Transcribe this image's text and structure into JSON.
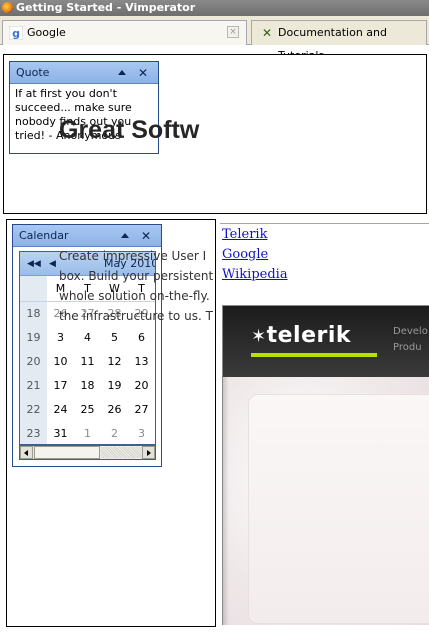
{
  "window": {
    "title": "Getting Started - Vimperator"
  },
  "tabs": [
    {
      "label": "Google",
      "icon": "google-icon"
    },
    {
      "label": "Documentation and Tutorials",
      "icon": "vimperator-icon"
    }
  ],
  "quote_widget": {
    "title": "Quote",
    "text": "If at first you don't succeed... make sure nobody finds out you tried! - Anonymous"
  },
  "calendar_widget": {
    "title": "Calendar",
    "month_label": "May 2010",
    "weekday_headers": [
      "M",
      "T",
      "W",
      "T"
    ],
    "weeks": [
      {
        "week": "18",
        "days": [
          {
            "d": "26",
            "other": true
          },
          {
            "d": "27",
            "other": true
          },
          {
            "d": "28",
            "other": true
          },
          {
            "d": "29",
            "other": true
          }
        ]
      },
      {
        "week": "19",
        "days": [
          {
            "d": "3"
          },
          {
            "d": "4"
          },
          {
            "d": "5"
          },
          {
            "d": "6"
          }
        ]
      },
      {
        "week": "20",
        "days": [
          {
            "d": "10"
          },
          {
            "d": "11"
          },
          {
            "d": "12"
          },
          {
            "d": "13"
          }
        ]
      },
      {
        "week": "21",
        "days": [
          {
            "d": "17"
          },
          {
            "d": "18"
          },
          {
            "d": "19"
          },
          {
            "d": "20"
          }
        ]
      },
      {
        "week": "22",
        "days": [
          {
            "d": "24"
          },
          {
            "d": "25"
          },
          {
            "d": "26"
          },
          {
            "d": "27"
          }
        ]
      },
      {
        "week": "23",
        "days": [
          {
            "d": "31"
          },
          {
            "d": "1",
            "other": true
          },
          {
            "d": "2",
            "other": true
          },
          {
            "d": "3",
            "other": true
          }
        ]
      }
    ]
  },
  "links": [
    "Telerik",
    "Google",
    "Wikipedia"
  ],
  "telerik_site": {
    "logo": "telerik",
    "logo_glyph": "✶",
    "nav_lines": [
      "Develo",
      "Produ"
    ],
    "hero_title": "Great Softw",
    "hero_copy": [
      "Create impressive User I",
      "box. Build your persistent",
      "whole solution on-the-fly.",
      "the infrastructure to us. T"
    ]
  },
  "colors": {
    "dock_title": "#8cb2e8",
    "logo_underline": "#b8e000",
    "link": "#1010c8"
  }
}
